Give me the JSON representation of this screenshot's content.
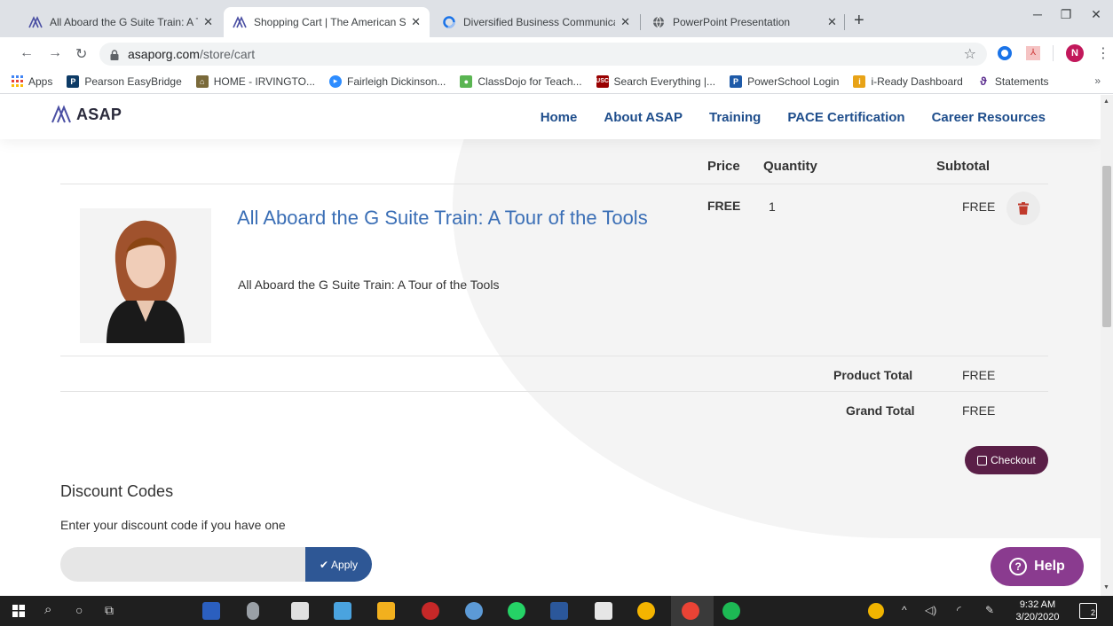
{
  "browser": {
    "tabs": [
      {
        "title": "All Aboard the G Suite Train: A To",
        "active": false
      },
      {
        "title": "Shopping Cart | The American So",
        "active": true
      },
      {
        "title": "Diversified Business Communicat",
        "active": false
      },
      {
        "title": "PowerPoint Presentation",
        "active": false
      }
    ],
    "new_tab": "+",
    "url_host": "asaporg.com",
    "url_path": "/store/cart",
    "profile_initial": "N",
    "bookmarks": [
      {
        "label": "Apps",
        "icon": "apps-grid-icon",
        "color": "#4285f4"
      },
      {
        "label": "Pearson EasyBridge",
        "icon": "pearson-icon",
        "color": "#0d3b66"
      },
      {
        "label": "HOME - IRVINGTO...",
        "icon": "school-icon",
        "color": "#7a6a3a"
      },
      {
        "label": "Fairleigh Dickinson...",
        "icon": "zoom-icon",
        "color": "#2d8cff"
      },
      {
        "label": "ClassDojo for Teach...",
        "icon": "classdojo-icon",
        "color": "#5ab552"
      },
      {
        "label": "Search Everything |...",
        "icon": "usc-icon",
        "color": "#990000"
      },
      {
        "label": "PowerSchool Login",
        "icon": "powerschool-icon",
        "color": "#1e5aa8"
      },
      {
        "label": "i-Ready Dashboard",
        "icon": "iready-icon",
        "color": "#e8a317"
      },
      {
        "label": "Statements",
        "icon": "statements-icon",
        "color": "#5b2d8e"
      }
    ],
    "bookmarks_more": "»"
  },
  "site": {
    "logo": "ASAP",
    "nav": [
      "Home",
      "About ASAP",
      "Training",
      "PACE Certification",
      "Career Resources"
    ]
  },
  "cart": {
    "headers": {
      "price": "Price",
      "quantity": "Quantity",
      "subtotal": "Subtotal"
    },
    "item": {
      "title": "All Aboard the G Suite Train: A Tour of the Tools",
      "description": "All Aboard the G Suite Train: A Tour of the Tools",
      "price": "FREE",
      "quantity": "1",
      "subtotal": "FREE"
    },
    "product_total_label": "Product Total",
    "product_total": "FREE",
    "grand_total_label": "Grand Total",
    "grand_total": "FREE",
    "checkout_label": "Checkout"
  },
  "discount": {
    "title": "Discount Codes",
    "subtitle": "Enter your discount code if you have one",
    "input_value": "",
    "apply_label": "Apply"
  },
  "help_label": "Help",
  "taskbar": {
    "time": "9:32 AM",
    "date": "3/20/2020",
    "notification_count": "2"
  },
  "colors": {
    "nav_blue": "#1f4e8c",
    "title_blue": "#3b6fb6",
    "checkout": "#5a1f47",
    "apply": "#2e5795",
    "help": "#8a3b8f"
  }
}
